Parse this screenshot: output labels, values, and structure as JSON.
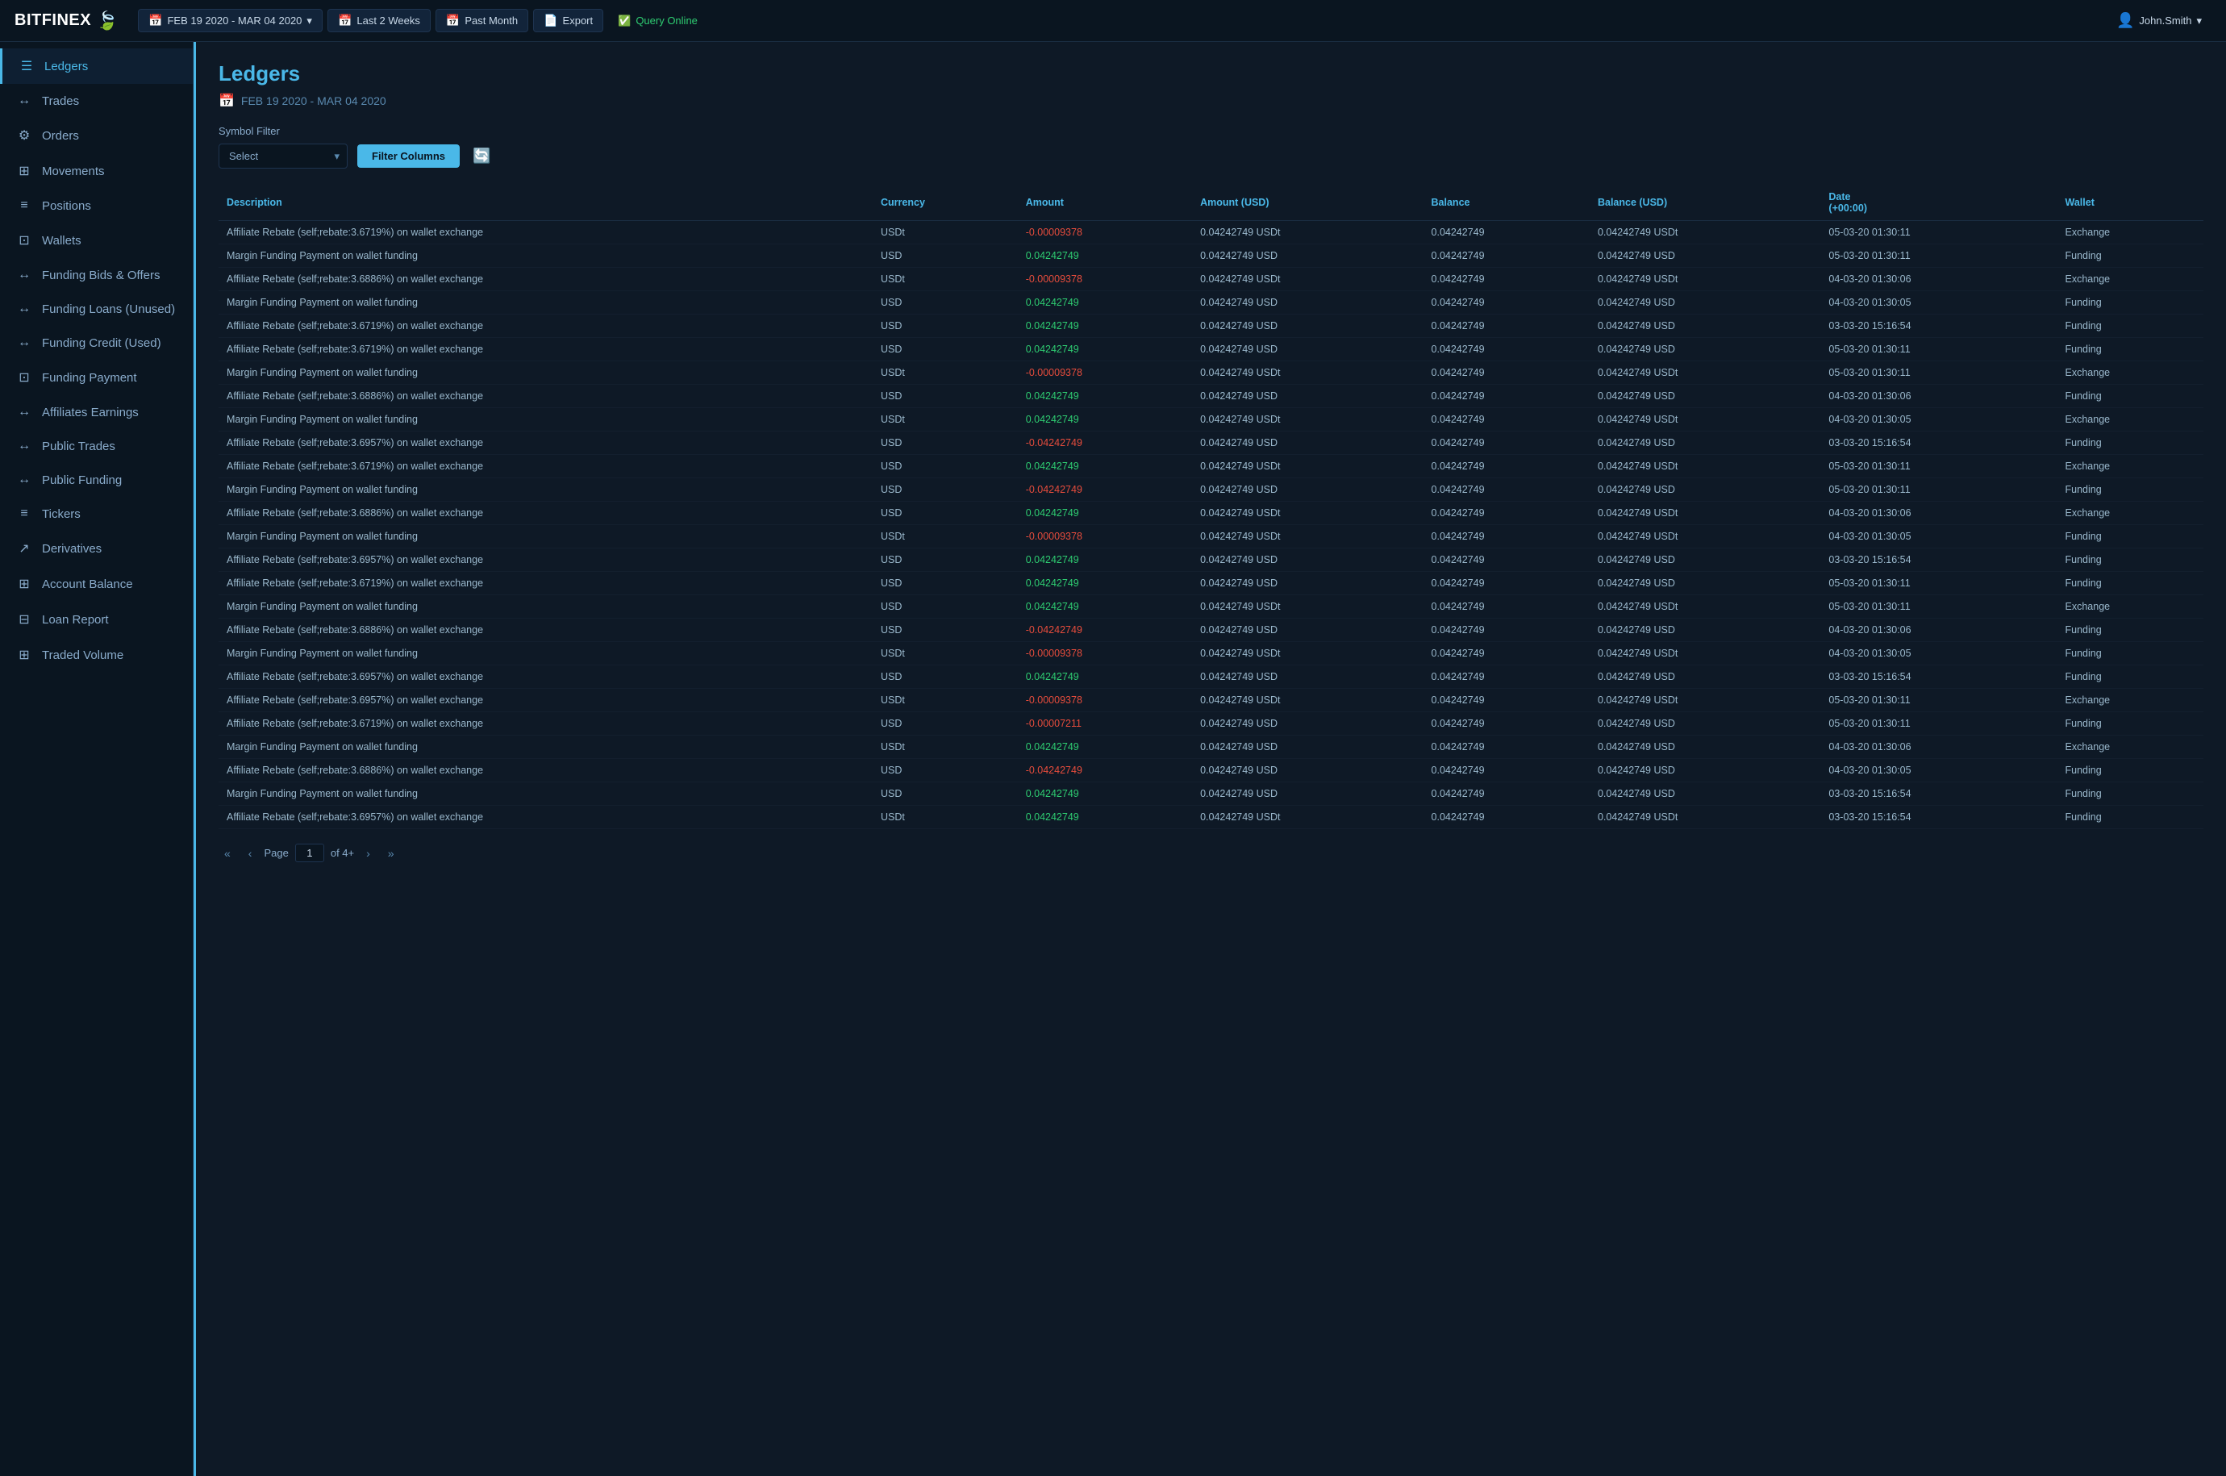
{
  "logo": {
    "text": "BITFINEX",
    "leaf": "🍃"
  },
  "topnav": {
    "date_range": "FEB 19 2020 - MAR  04 2020",
    "last2weeks": "Last 2 Weeks",
    "past_month": "Past Month",
    "export": "Export",
    "query_online": "Query Online",
    "user": "John.Smith"
  },
  "sidebar": {
    "items": [
      {
        "label": "Ledgers",
        "icon": "☰",
        "active": true
      },
      {
        "label": "Trades",
        "icon": "↔",
        "active": false
      },
      {
        "label": "Orders",
        "icon": "⚙",
        "active": false
      },
      {
        "label": "Movements",
        "icon": "⊞",
        "active": false
      },
      {
        "label": "Positions",
        "icon": "≡",
        "active": false
      },
      {
        "label": "Wallets",
        "icon": "⊡",
        "active": false
      },
      {
        "label": "Funding Bids & Offers",
        "icon": "↔",
        "active": false
      },
      {
        "label": "Funding Loans (Unused)",
        "icon": "↔",
        "active": false
      },
      {
        "label": "Funding Credit (Used)",
        "icon": "↔",
        "active": false
      },
      {
        "label": "Funding Payment",
        "icon": "⊡",
        "active": false
      },
      {
        "label": "Affiliates Earnings",
        "icon": "↔",
        "active": false
      },
      {
        "label": "Public Trades",
        "icon": "↔",
        "active": false
      },
      {
        "label": "Public Funding",
        "icon": "↔",
        "active": false
      },
      {
        "label": "Tickers",
        "icon": "≡",
        "active": false
      },
      {
        "label": "Derivatives",
        "icon": "↗",
        "active": false
      },
      {
        "label": "Account Balance",
        "icon": "⊞",
        "active": false
      },
      {
        "label": "Loan Report",
        "icon": "⊟",
        "active": false
      },
      {
        "label": "Traded Volume",
        "icon": "⊞",
        "active": false
      }
    ]
  },
  "content": {
    "page_title": "Ledgers",
    "date_range_display": "FEB 19 2020 - MAR  04 2020",
    "symbol_filter_label": "Symbol Filter",
    "symbol_filter_placeholder": "Select",
    "filter_columns_btn": "Filter Columns",
    "table": {
      "columns": [
        "Description",
        "Currency",
        "Amount",
        "Amount (USD)",
        "Balance",
        "Balance (USD)",
        "Date\n(+00:00)",
        "Wallet"
      ],
      "rows": [
        {
          "desc": "Affiliate Rebate (self;rebate:3.6719%) on wallet exchange",
          "currency": "USDt",
          "amount": "-0.00009378",
          "amount_usd": "0.04242749 USDt",
          "balance": "0.04242749",
          "balance_usd": "0.04242749 USDt",
          "date": "05-03-20 01:30:11",
          "wallet": "Exchange",
          "amt_class": "amt-neg"
        },
        {
          "desc": "Margin Funding Payment on wallet funding",
          "currency": "USD",
          "amount": "0.04242749",
          "amount_usd": "0.04242749 USD",
          "balance": "0.04242749",
          "balance_usd": "0.04242749 USD",
          "date": "05-03-20 01:30:11",
          "wallet": "Funding",
          "amt_class": "amt-pos"
        },
        {
          "desc": "Affiliate Rebate (self;rebate:3.6886%) on wallet exchange",
          "currency": "USDt",
          "amount": "-0.00009378",
          "amount_usd": "0.04242749 USDt",
          "balance": "0.04242749",
          "balance_usd": "0.04242749 USDt",
          "date": "04-03-20 01:30:06",
          "wallet": "Exchange",
          "amt_class": "amt-neg"
        },
        {
          "desc": "Margin Funding Payment on wallet funding",
          "currency": "USD",
          "amount": "0.04242749",
          "amount_usd": "0.04242749 USD",
          "balance": "0.04242749",
          "balance_usd": "0.04242749 USD",
          "date": "04-03-20 01:30:05",
          "wallet": "Funding",
          "amt_class": "amt-pos"
        },
        {
          "desc": "Affiliate Rebate (self;rebate:3.6719%) on wallet exchange",
          "currency": "USD",
          "amount": "0.04242749",
          "amount_usd": "0.04242749 USD",
          "balance": "0.04242749",
          "balance_usd": "0.04242749 USD",
          "date": "03-03-20 15:16:54",
          "wallet": "Funding",
          "amt_class": "amt-pos"
        },
        {
          "desc": "Affiliate Rebate (self;rebate:3.6719%) on wallet exchange",
          "currency": "USD",
          "amount": "0.04242749",
          "amount_usd": "0.04242749 USD",
          "balance": "0.04242749",
          "balance_usd": "0.04242749 USD",
          "date": "05-03-20 01:30:11",
          "wallet": "Funding",
          "amt_class": "amt-pos"
        },
        {
          "desc": "Margin Funding Payment on wallet funding",
          "currency": "USDt",
          "amount": "-0.00009378",
          "amount_usd": "0.04242749 USDt",
          "balance": "0.04242749",
          "balance_usd": "0.04242749 USDt",
          "date": "05-03-20 01:30:11",
          "wallet": "Exchange",
          "amt_class": "amt-neg"
        },
        {
          "desc": "Affiliate Rebate (self;rebate:3.6886%) on wallet exchange",
          "currency": "USD",
          "amount": "0.04242749",
          "amount_usd": "0.04242749 USD",
          "balance": "0.04242749",
          "balance_usd": "0.04242749 USD",
          "date": "04-03-20 01:30:06",
          "wallet": "Funding",
          "amt_class": "amt-pos"
        },
        {
          "desc": "Margin Funding Payment on wallet funding",
          "currency": "USDt",
          "amount": "0.04242749",
          "amount_usd": "0.04242749 USDt",
          "balance": "0.04242749",
          "balance_usd": "0.04242749 USDt",
          "date": "04-03-20 01:30:05",
          "wallet": "Exchange",
          "amt_class": "amt-pos"
        },
        {
          "desc": "Affiliate Rebate (self;rebate:3.6957%) on wallet exchange",
          "currency": "USD",
          "amount": "-0.04242749",
          "amount_usd": "0.04242749 USD",
          "balance": "0.04242749",
          "balance_usd": "0.04242749 USD",
          "date": "03-03-20 15:16:54",
          "wallet": "Funding",
          "amt_class": "amt-neg"
        },
        {
          "desc": "Affiliate Rebate (self;rebate:3.6719%) on wallet exchange",
          "currency": "USD",
          "amount": "0.04242749",
          "amount_usd": "0.04242749 USDt",
          "balance": "0.04242749",
          "balance_usd": "0.04242749 USDt",
          "date": "05-03-20 01:30:11",
          "wallet": "Exchange",
          "amt_class": "amt-pos"
        },
        {
          "desc": "Margin Funding Payment on wallet funding",
          "currency": "USD",
          "amount": "-0.04242749",
          "amount_usd": "0.04242749 USD",
          "balance": "0.04242749",
          "balance_usd": "0.04242749 USD",
          "date": "05-03-20 01:30:11",
          "wallet": "Funding",
          "amt_class": "amt-neg"
        },
        {
          "desc": "Affiliate Rebate (self;rebate:3.6886%) on wallet exchange",
          "currency": "USD",
          "amount": "0.04242749",
          "amount_usd": "0.04242749 USDt",
          "balance": "0.04242749",
          "balance_usd": "0.04242749 USDt",
          "date": "04-03-20 01:30:06",
          "wallet": "Exchange",
          "amt_class": "amt-pos"
        },
        {
          "desc": "Margin Funding Payment on wallet funding",
          "currency": "USDt",
          "amount": "-0.00009378",
          "amount_usd": "0.04242749 USDt",
          "balance": "0.04242749",
          "balance_usd": "0.04242749 USDt",
          "date": "04-03-20 01:30:05",
          "wallet": "Funding",
          "amt_class": "amt-neg"
        },
        {
          "desc": "Affiliate Rebate (self;rebate:3.6957%) on wallet exchange",
          "currency": "USD",
          "amount": "0.04242749",
          "amount_usd": "0.04242749 USD",
          "balance": "0.04242749",
          "balance_usd": "0.04242749 USD",
          "date": "03-03-20 15:16:54",
          "wallet": "Funding",
          "amt_class": "amt-pos"
        },
        {
          "desc": "Affiliate Rebate (self;rebate:3.6719%) on wallet exchange",
          "currency": "USD",
          "amount": "0.04242749",
          "amount_usd": "0.04242749 USD",
          "balance": "0.04242749",
          "balance_usd": "0.04242749 USD",
          "date": "05-03-20 01:30:11",
          "wallet": "Funding",
          "amt_class": "amt-pos"
        },
        {
          "desc": "Margin Funding Payment on wallet funding",
          "currency": "USD",
          "amount": "0.04242749",
          "amount_usd": "0.04242749 USDt",
          "balance": "0.04242749",
          "balance_usd": "0.04242749 USDt",
          "date": "05-03-20 01:30:11",
          "wallet": "Exchange",
          "amt_class": "amt-pos"
        },
        {
          "desc": "Affiliate Rebate (self;rebate:3.6886%) on wallet exchange",
          "currency": "USD",
          "amount": "-0.04242749",
          "amount_usd": "0.04242749 USD",
          "balance": "0.04242749",
          "balance_usd": "0.04242749 USD",
          "date": "04-03-20 01:30:06",
          "wallet": "Funding",
          "amt_class": "amt-neg"
        },
        {
          "desc": "Margin Funding Payment on wallet funding",
          "currency": "USDt",
          "amount": "-0.00009378",
          "amount_usd": "0.04242749 USDt",
          "balance": "0.04242749",
          "balance_usd": "0.04242749 USDt",
          "date": "04-03-20 01:30:05",
          "wallet": "Funding",
          "amt_class": "amt-neg"
        },
        {
          "desc": "Affiliate Rebate (self;rebate:3.6957%) on wallet exchange",
          "currency": "USD",
          "amount": "0.04242749",
          "amount_usd": "0.04242749 USD",
          "balance": "0.04242749",
          "balance_usd": "0.04242749 USD",
          "date": "03-03-20 15:16:54",
          "wallet": "Funding",
          "amt_class": "amt-pos"
        },
        {
          "desc": "Affiliate Rebate (self;rebate:3.6957%) on wallet exchange",
          "currency": "USDt",
          "amount": "-0.00009378",
          "amount_usd": "0.04242749 USDt",
          "balance": "0.04242749",
          "balance_usd": "0.04242749 USDt",
          "date": "05-03-20 01:30:11",
          "wallet": "Exchange",
          "amt_class": "amt-neg"
        },
        {
          "desc": "Affiliate Rebate (self;rebate:3.6719%) on wallet exchange",
          "currency": "USD",
          "amount": "-0.00007211",
          "amount_usd": "0.04242749 USD",
          "balance": "0.04242749",
          "balance_usd": "0.04242749 USD",
          "date": "05-03-20 01:30:11",
          "wallet": "Funding",
          "amt_class": "amt-neg"
        },
        {
          "desc": "Margin Funding Payment on wallet funding",
          "currency": "USDt",
          "amount": "0.04242749",
          "amount_usd": "0.04242749 USD",
          "balance": "0.04242749",
          "balance_usd": "0.04242749 USD",
          "date": "04-03-20 01:30:06",
          "wallet": "Exchange",
          "amt_class": "amt-pos"
        },
        {
          "desc": "Affiliate Rebate (self;rebate:3.6886%) on wallet exchange",
          "currency": "USD",
          "amount": "-0.04242749",
          "amount_usd": "0.04242749 USD",
          "balance": "0.04242749",
          "balance_usd": "0.04242749 USD",
          "date": "04-03-20 01:30:05",
          "wallet": "Funding",
          "amt_class": "amt-neg"
        },
        {
          "desc": "Margin Funding Payment on wallet funding",
          "currency": "USD",
          "amount": "0.04242749",
          "amount_usd": "0.04242749 USD",
          "balance": "0.04242749",
          "balance_usd": "0.04242749 USD",
          "date": "03-03-20 15:16:54",
          "wallet": "Funding",
          "amt_class": "amt-pos"
        },
        {
          "desc": "Affiliate Rebate (self;rebate:3.6957%) on wallet exchange",
          "currency": "USDt",
          "amount": "0.04242749",
          "amount_usd": "0.04242749 USDt",
          "balance": "0.04242749",
          "balance_usd": "0.04242749 USDt",
          "date": "03-03-20 15:16:54",
          "wallet": "Funding",
          "amt_class": "amt-pos"
        }
      ]
    },
    "pagination": {
      "page_label": "Page",
      "current_page": "1",
      "total_pages": "of 4+"
    }
  }
}
